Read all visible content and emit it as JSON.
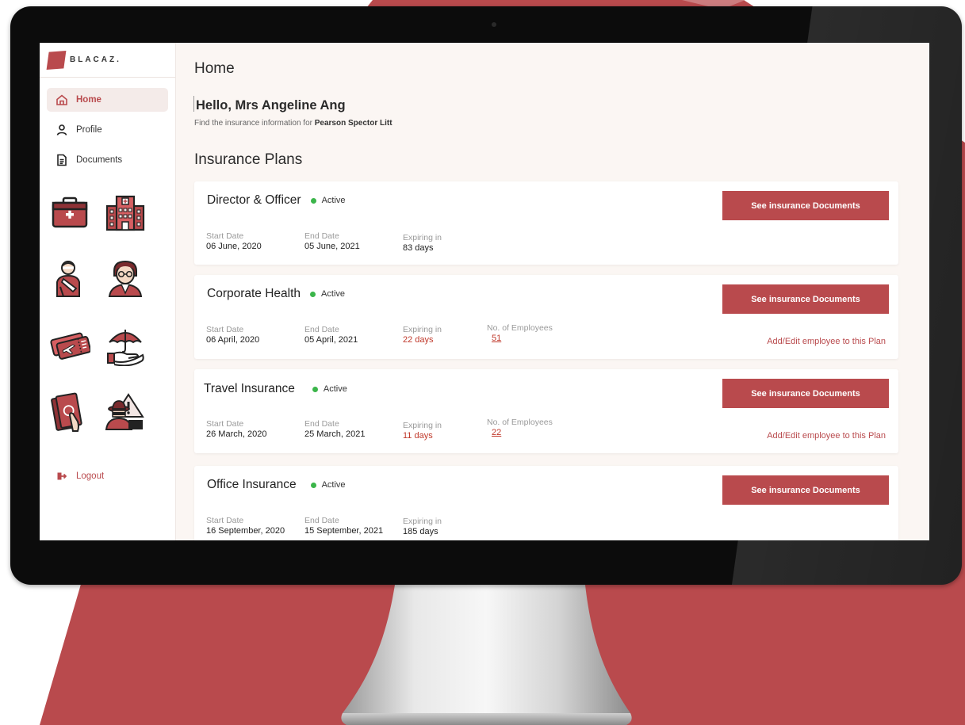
{
  "colors": {
    "accent": "#b94a4d",
    "active": "#3bb54a",
    "expiring": "#c0392b",
    "background_shape": "#b94a4d"
  },
  "brand": {
    "name": "BLACAZ."
  },
  "sidebar": {
    "items": [
      {
        "label": "Home",
        "icon": "home-icon",
        "active": true
      },
      {
        "label": "Profile",
        "icon": "user-icon",
        "active": false
      },
      {
        "label": "Documents",
        "icon": "document-icon",
        "active": false
      }
    ],
    "illustrations": [
      "medical-kit-icon",
      "hospital-building-icon",
      "injured-person-icon",
      "office-worker-icon",
      "travel-tickets-icon",
      "umbrella-protection-icon",
      "cash-in-hand-icon",
      "fraud-warning-icon"
    ],
    "logout_label": "Logout"
  },
  "main": {
    "page_title": "Home",
    "greeting": "Hello, Mrs Angeline Ang",
    "subline_prefix": "Find the insurance information for ",
    "company": "Pearson Spector Litt",
    "section_title": "Insurance Plans",
    "labels": {
      "start": "Start Date",
      "end": "End Date",
      "expiring": "Expiring in",
      "employees": "No. of Employees",
      "status": "Active",
      "doc_button": "See insurance Documents",
      "add_employee": "Add/Edit employee to this Plan"
    },
    "plans": [
      {
        "name": "Director & Officer",
        "start": "06 June, 2020",
        "end": "05 June, 2021",
        "expiring": "83 days",
        "expiring_urgent": false,
        "employees": null
      },
      {
        "name": "Corporate Health",
        "start": "06 April, 2020",
        "end": "05 April, 2021",
        "expiring": "22 days",
        "expiring_urgent": true,
        "employees": "51"
      },
      {
        "name": "Travel Insurance",
        "start": "26 March, 2020",
        "end": "25 March, 2021",
        "expiring": "11 days",
        "expiring_urgent": true,
        "employees": "22"
      },
      {
        "name": "Office Insurance",
        "start": "16 September, 2020",
        "end": "15 September, 2021",
        "expiring": "185 days",
        "expiring_urgent": false,
        "employees": null
      }
    ]
  }
}
